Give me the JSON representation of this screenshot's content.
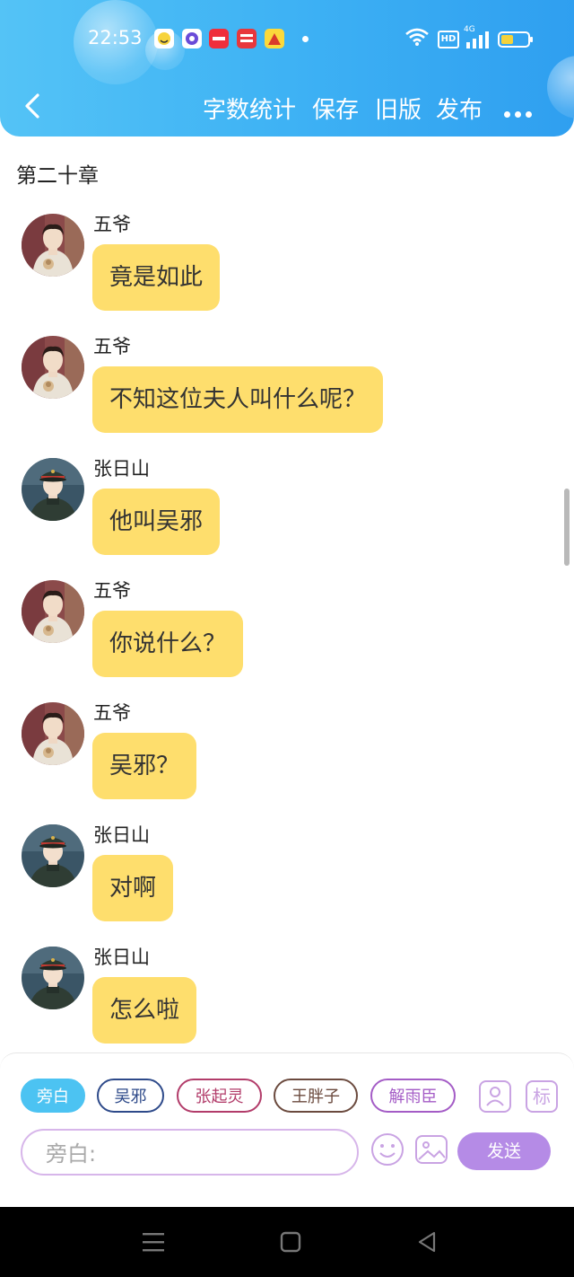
{
  "status_bar": {
    "time": "22:53",
    "app_icons": [
      "smile-app-icon",
      "chat-app-icon",
      "xiaohongshu-app-icon",
      "toutiao-app-icon",
      "bird-app-icon"
    ],
    "network": "4G",
    "hd_label": "HD"
  },
  "nav": {
    "word_count": "字数统计",
    "save": "保存",
    "old_version": "旧版",
    "publish": "发布"
  },
  "chapter_title": "第二十章",
  "messages": [
    {
      "sender": "五爷",
      "text": "竟是如此",
      "avatar": "wuye"
    },
    {
      "sender": "五爷",
      "text": "不知这位夫人叫什么呢？",
      "avatar": "wuye"
    },
    {
      "sender": "张日山",
      "text": "他叫吴邪",
      "avatar": "zhangrishan"
    },
    {
      "sender": "五爷",
      "text": "你说什么？",
      "avatar": "wuye"
    },
    {
      "sender": "五爷",
      "text": "吴邪？",
      "avatar": "wuye"
    },
    {
      "sender": "张日山",
      "text": "对啊",
      "avatar": "zhangrishan"
    },
    {
      "sender": "张日山",
      "text": "怎么啦",
      "avatar": "zhangrishan"
    }
  ],
  "composer": {
    "characters": [
      {
        "label": "旁白",
        "color": "#4cc3f2",
        "selected": true
      },
      {
        "label": "吴邪",
        "color": "#2e4a8a",
        "selected": false
      },
      {
        "label": "张起灵",
        "color": "#b23c6a",
        "selected": false
      },
      {
        "label": "王胖子",
        "color": "#6b4a3e",
        "selected": false
      },
      {
        "label": "解雨臣",
        "color": "#a45cc6",
        "selected": false
      }
    ],
    "mark_label": "标",
    "input_placeholder": "旁白:",
    "send_label": "发送"
  },
  "colors": {
    "header": "#3eb2f4",
    "bubble": "#fede6d",
    "accent": "#b58be6"
  }
}
